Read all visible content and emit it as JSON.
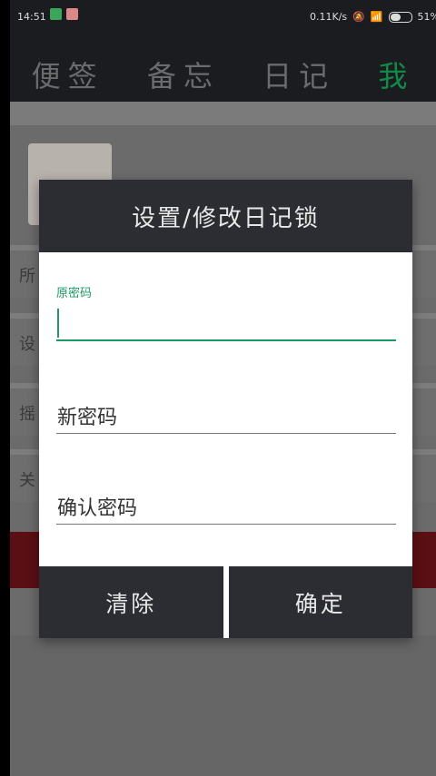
{
  "status_bar": {
    "time": "14:51",
    "network_speed": "0.11K/s",
    "battery": "51%"
  },
  "tabs": [
    {
      "label": "便签"
    },
    {
      "label": "备忘"
    },
    {
      "label": "日记"
    },
    {
      "label": "我"
    }
  ],
  "colors": {
    "accent": "#1e9b64",
    "dialog_header": "#2b2d33",
    "active_tab": "#128a47"
  },
  "background_rows": [
    {
      "label": "所"
    },
    {
      "label": "设"
    },
    {
      "label": "摇"
    },
    {
      "label": "关"
    }
  ],
  "dialog": {
    "title": "设置/修改日记锁",
    "fields": {
      "old_password_label": "原密码",
      "old_password_value": "",
      "new_password_placeholder": "新密码",
      "confirm_password_placeholder": "确认密码"
    },
    "buttons": {
      "clear": "清除",
      "confirm": "确定"
    }
  }
}
